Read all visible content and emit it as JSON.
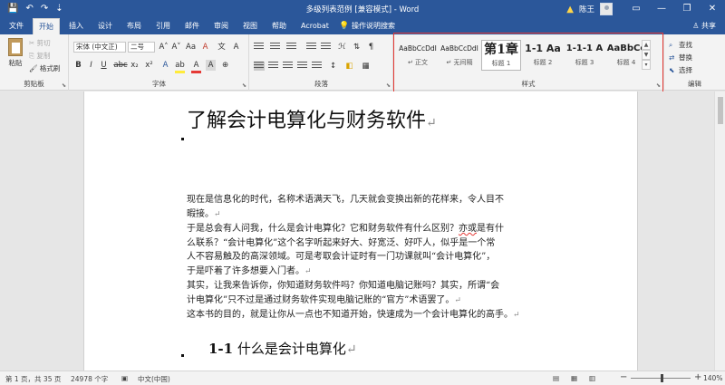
{
  "window": {
    "title": "多级列表范例 [兼容模式] - Word",
    "user": "陈王",
    "min": "—",
    "restore": "❐",
    "close": "✕"
  },
  "qat": {
    "save": "💾",
    "undo": "↶",
    "redo": "↷",
    "more": "⇣"
  },
  "tabs": [
    {
      "label": "文件"
    },
    {
      "label": "开始"
    },
    {
      "label": "插入"
    },
    {
      "label": "设计"
    },
    {
      "label": "布局"
    },
    {
      "label": "引用"
    },
    {
      "label": "邮件"
    },
    {
      "label": "审阅"
    },
    {
      "label": "视图"
    },
    {
      "label": "帮助"
    },
    {
      "label": "Acrobat"
    }
  ],
  "tell_me": "操作说明搜索",
  "share": "♙ 共享",
  "clipboard": {
    "paste": "粘贴",
    "cut": "✂ 剪切",
    "copy": "⎘ 复制",
    "format_painter": "格式刷",
    "group": "剪贴板"
  },
  "font": {
    "name": "宋体 (中文正)",
    "size": "二号",
    "group": "字体",
    "bold": "B",
    "italic": "I",
    "underline": "U",
    "strike": "abc",
    "sub": "x₂",
    "sup": "x²",
    "grow": "A˄",
    "shrink": "A˅",
    "case": "Aa",
    "clear": "A"
  },
  "paragraph": {
    "group": "段落"
  },
  "styles": {
    "group": "样式",
    "items": [
      {
        "preview": "AaBbCcDdI",
        "name": "↵ 正文"
      },
      {
        "preview": "AaBbCcDdI",
        "name": "↵ 无间隔"
      },
      {
        "preview": "第1章",
        "name": "标题 1"
      },
      {
        "preview": "1-1  Aa",
        "name": "标题 2"
      },
      {
        "preview": "1-1-1  A",
        "name": "标题 3"
      },
      {
        "preview": "AaBbCc",
        "name": "标题 4"
      }
    ]
  },
  "editing": {
    "find": "查找",
    "replace": "替换",
    "select": "选择",
    "group": "编辑"
  },
  "doc": {
    "title": "了解会计电算化与财务软件",
    "lines": [
      "现在是信息化的时代，名称术语满天飞，几天就会变换出新的花样来，令人目不",
      "暇接。",
      "于是总会有人问我，什么是会计电算化？它和财务软件有什么区别？",
      "亦或",
      "是有什",
      "么联系？“会计电算化”这个名字听起来好大、好宽泛、好吓人，似乎是一个常",
      "人不容易触及的高深领域。可是考取会计证时有一门功课就叫“会计电算化”，",
      "于是吓着了许多想要入门者。",
      "其实，让我来告诉你，你知道财务软件吗？你知道电脑记账吗？其实，所谓“会",
      "计电算化”只不过是通过财务软件实现电脑记账的“官方”术语罢了。",
      "这本书的目的，就是让你从一点也不知道开始，快速成为一个会计电算化的高手。"
    ],
    "heading_num": "1-1",
    "heading_text": " 什么是会计电算化",
    "pilcrow": "↵"
  },
  "status": {
    "page": "第 1 页，共 35 页",
    "words": "24978 个字",
    "lang": "中文(中国)",
    "zoom": "140%",
    "zoom_minus": "−",
    "zoom_plus": "+"
  }
}
